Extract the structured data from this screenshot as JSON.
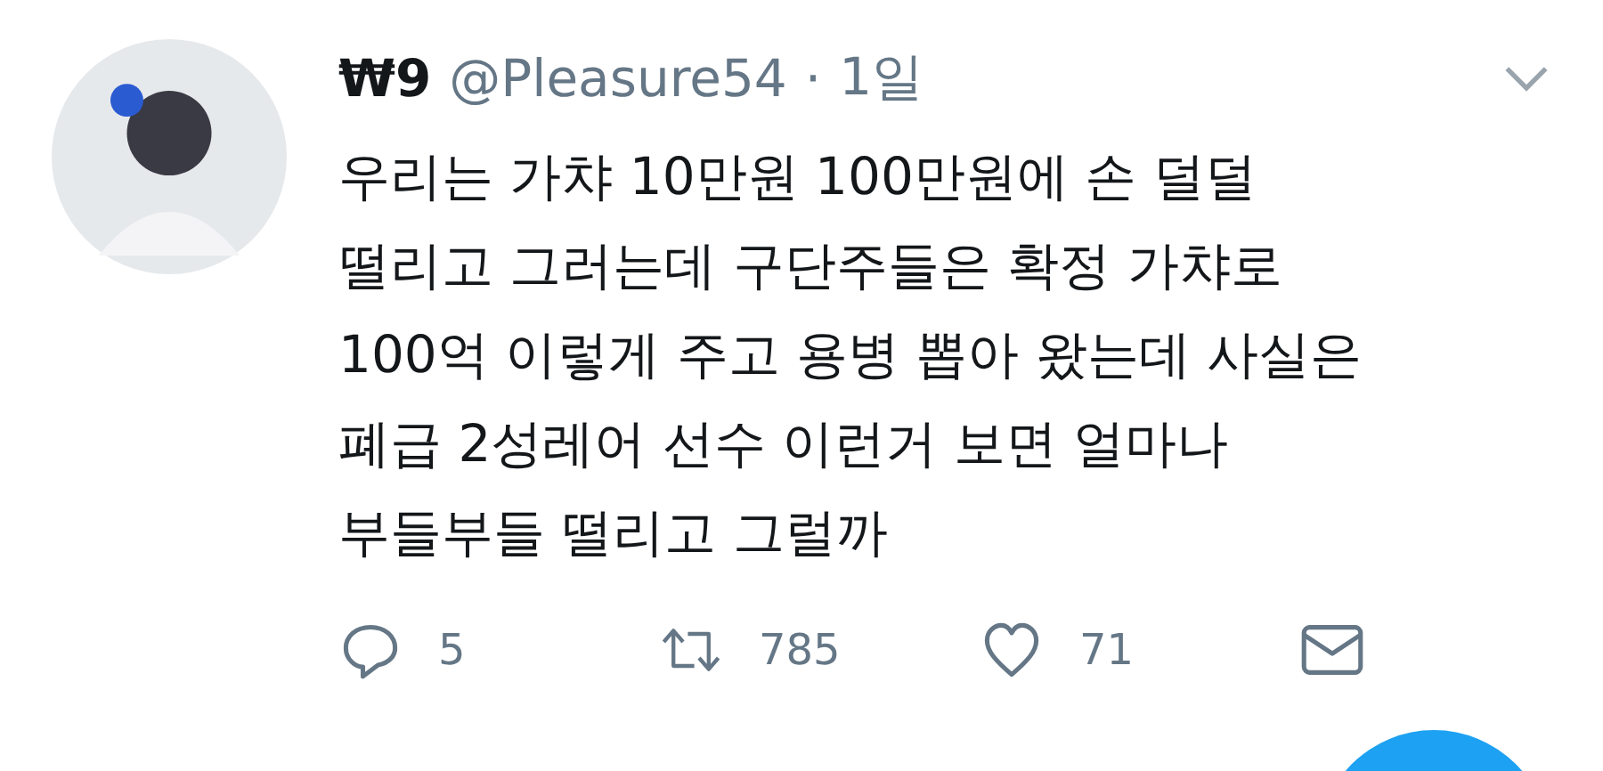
{
  "tweet": {
    "display_name": "₩9",
    "handle": "@Pleasure54",
    "separator": "·",
    "time": "1일",
    "lines": [
      "우리는 가챠 10만원 100만원에 손 덜덜",
      "떨리고 그러는데 구단주들은 확정 가챠로",
      "100억 이렇게 주고 용병 뽑아 왔는데 사실은",
      "폐급 2성레어 선수 이런거 보면 얼마나",
      "부들부들 떨리고 그럴까"
    ],
    "actions": [
      {
        "kind": "reply",
        "count": "5"
      },
      {
        "kind": "retweet",
        "count": "785"
      },
      {
        "kind": "like",
        "count": "71"
      },
      {
        "kind": "message"
      }
    ]
  }
}
